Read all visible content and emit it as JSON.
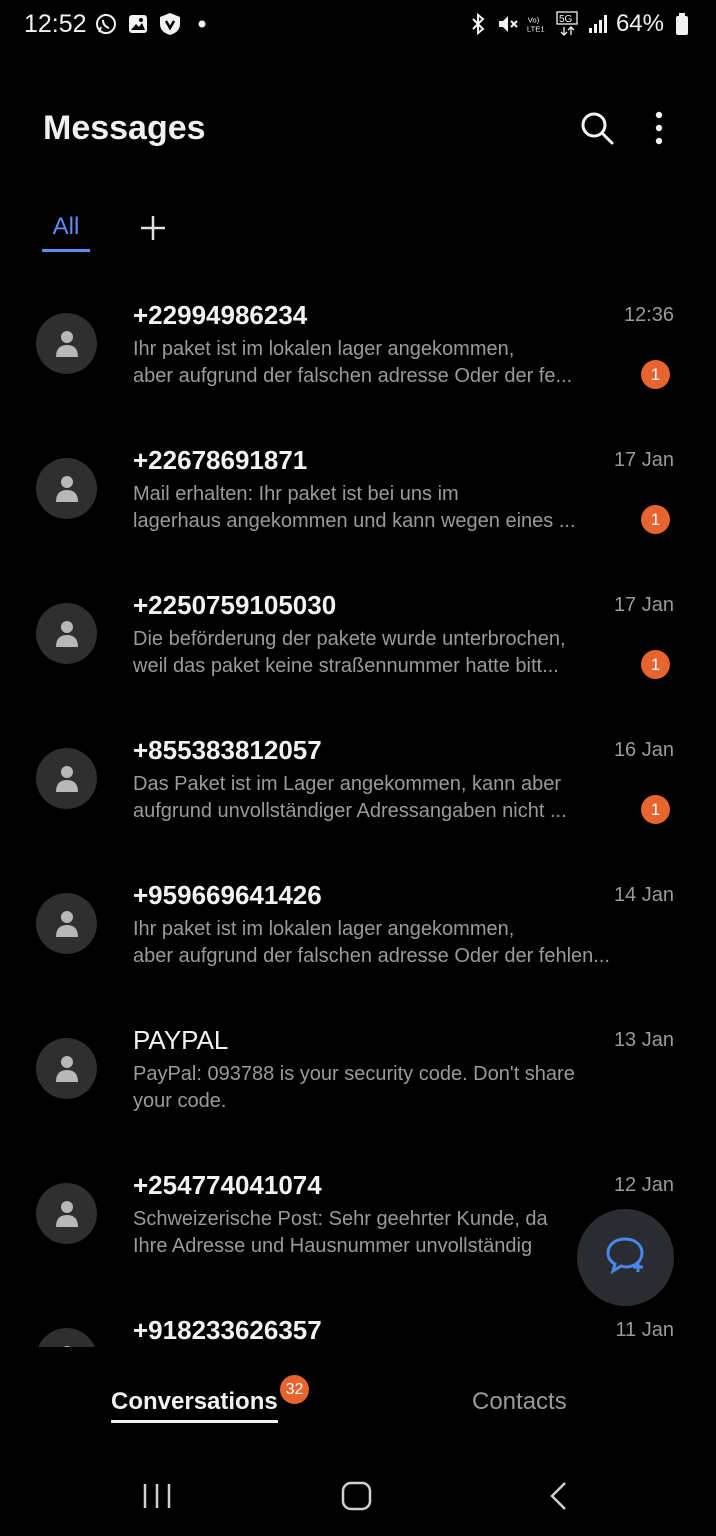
{
  "status_bar": {
    "time": "12:52",
    "battery": "64%",
    "left_icons": [
      "whatsapp-icon",
      "gallery-icon",
      "shield-app-icon",
      "dot-icon"
    ],
    "right_icons": [
      "bluetooth-icon",
      "mute-icon",
      "volte-icon",
      "5g-icon",
      "signal-icon",
      "battery-icon"
    ],
    "volte_label": "Vo)\nLTE1",
    "network_label": "5G"
  },
  "header": {
    "title": "Messages",
    "search_icon": "search-icon",
    "more_icon": "more-vertical-icon"
  },
  "tabs": {
    "all_label": "All",
    "add_icon": "plus-icon"
  },
  "conversations": [
    {
      "sender": "+22994986234",
      "date": "12:36",
      "line1": "Ihr paket ist im lokalen lager angekommen,",
      "line2": "aber aufgrund der falschen adresse Oder der fe...",
      "unread": "1"
    },
    {
      "sender": "+22678691871",
      "date": "17 Jan",
      "line1": "Mail erhalten: Ihr paket ist bei uns im",
      "line2": "lagerhaus angekommen und kann wegen eines ...",
      "unread": "1"
    },
    {
      "sender": "+2250759105030",
      "date": "17 Jan",
      "line1": "Die beförderung der pakete wurde unterbrochen,",
      "line2": "weil das paket keine straßennummer hatte bitt...",
      "unread": "1"
    },
    {
      "sender": "+855383812057",
      "date": "16 Jan",
      "line1": "Das Paket ist im Lager angekommen, kann aber",
      "line2": "aufgrund unvollständiger Adressangaben nicht ...",
      "unread": "1"
    },
    {
      "sender": "+959669641426",
      "date": "14 Jan",
      "line1": "Ihr paket ist im lokalen lager angekommen,",
      "line2": "aber aufgrund der falschen adresse Oder der fehlen...",
      "unread": ""
    },
    {
      "sender": "PAYPAL",
      "date": "13 Jan",
      "line1": "PayPal: 093788 is your security code. Don't share",
      "line2": "your code.",
      "unread": ""
    },
    {
      "sender": "+254774041074",
      "date": "12 Jan",
      "line1": "Schweizerische Post: Sehr geehrter Kunde, da",
      "line2": "Ihre Adresse und Hausnummer unvollständig",
      "unread": ""
    },
    {
      "sender": "+918233626357",
      "date": "11 Jan",
      "line1": "",
      "line2": "",
      "unread": ""
    }
  ],
  "fab": {
    "icon": "new-message-icon"
  },
  "bottom_tabs": {
    "conversations_label": "Conversations",
    "conversations_badge": "32",
    "contacts_label": "Contacts"
  },
  "nav_bar": {
    "icons": [
      "recents-icon",
      "home-icon",
      "back-icon"
    ]
  },
  "colors": {
    "background": "#000000",
    "accent": "#5a8ef5",
    "badge": "#e8642e",
    "secondary_text": "#9a9a9a"
  }
}
